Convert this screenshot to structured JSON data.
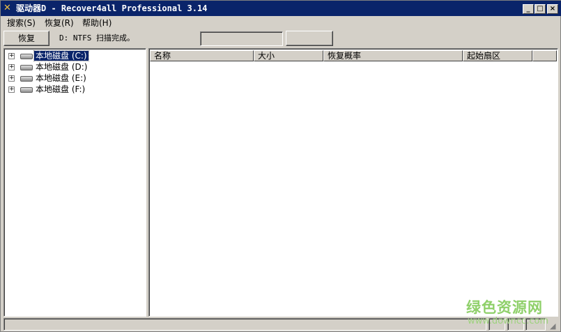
{
  "window": {
    "title": "驱动器D - Recover4all Professional 3.14",
    "icon": "app-tools-icon",
    "minimize": "_",
    "maximize": "□",
    "close": "×"
  },
  "menu": [
    "搜索(S)",
    "恢复(R)",
    "帮助(H)"
  ],
  "toolbar": {
    "recover_label": "恢复",
    "status": "D: NTFS 扫描完成。"
  },
  "tree": [
    {
      "label": "本地磁盘 (C:)",
      "selected": true
    },
    {
      "label": "本地磁盘 (D:)"
    },
    {
      "label": "本地磁盘 (E:)"
    },
    {
      "label": "本地磁盘 (F:)"
    }
  ],
  "list": {
    "columns": [
      "名称",
      "大小",
      "恢复概率",
      "起始扇区"
    ],
    "rows": []
  },
  "watermark": {
    "name": "绿色资源网",
    "url": "www.downcc.com"
  }
}
